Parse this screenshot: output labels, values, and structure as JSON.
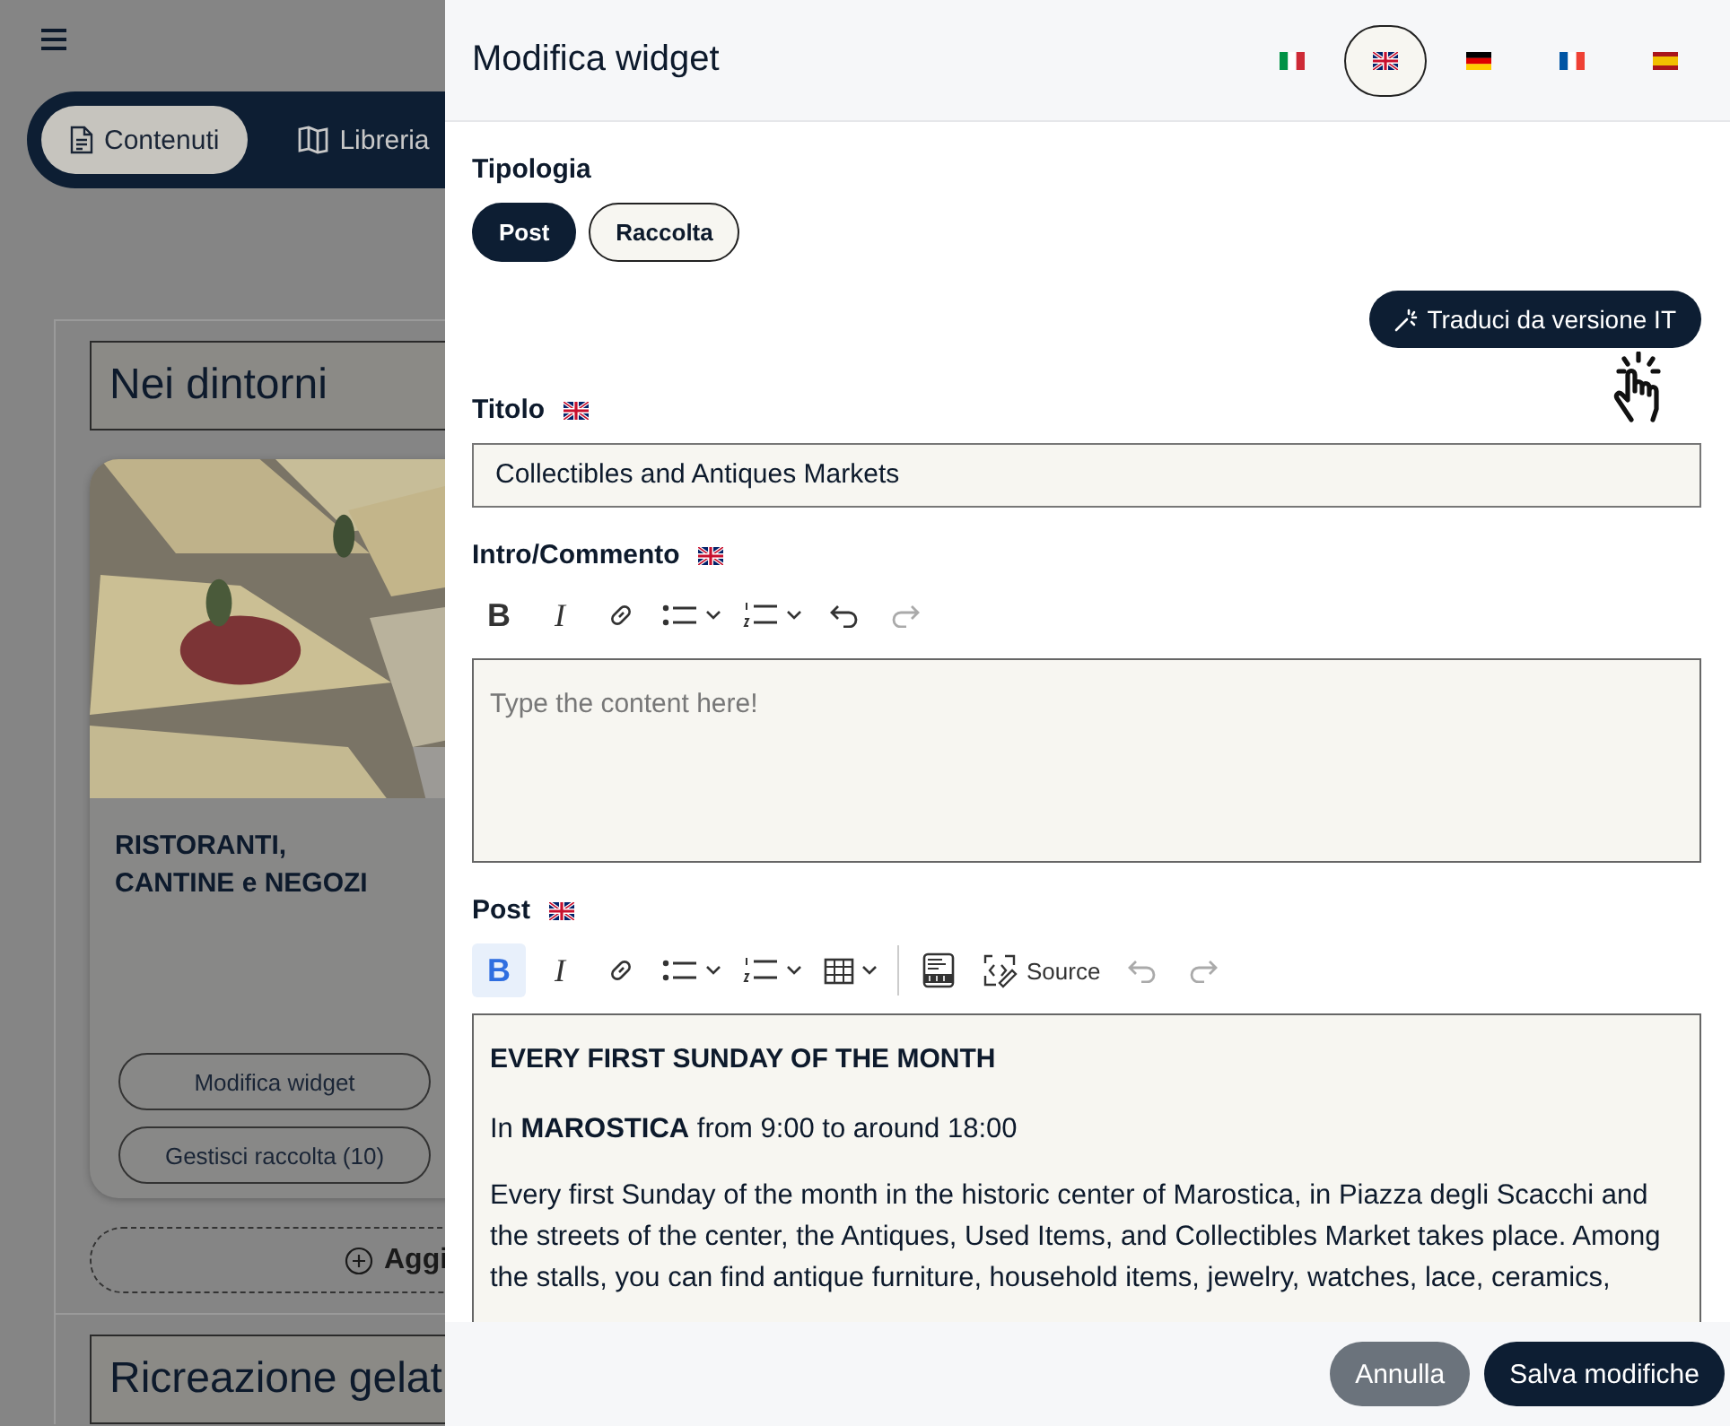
{
  "background": {
    "tabs": [
      {
        "label": "Contenuti",
        "selected": true
      },
      {
        "label": "Libreria",
        "selected": false
      }
    ],
    "sections": [
      {
        "title": "Nei dintorni",
        "card": {
          "title": "RISTORANTI,\nCANTINE e NEGOZI",
          "buttons": [
            "Modifica widget",
            "Gestisci raccolta (10)"
          ]
        },
        "add_button": "Aggi"
      },
      {
        "title": "Ricreazione gelat"
      }
    ]
  },
  "drawer": {
    "title": "Modifica widget",
    "languages": [
      {
        "kind": "it",
        "selected": false
      },
      {
        "kind": "en",
        "selected": true
      },
      {
        "kind": "de",
        "selected": false
      },
      {
        "kind": "fr",
        "selected": false
      },
      {
        "kind": "es",
        "selected": false
      }
    ],
    "type": {
      "label": "Tipologia",
      "options": [
        {
          "label": "Post",
          "selected": true
        },
        {
          "label": "Raccolta",
          "selected": false
        }
      ]
    },
    "translate_button": "Traduci da versione IT",
    "title_field": {
      "label": "Titolo",
      "value": "Collectibles and Antiques Markets"
    },
    "intro": {
      "label": "Intro/Commento",
      "placeholder": "Type the content here!",
      "toolbar": [
        [
          {
            "kind": "bold",
            "label": "B",
            "active": false,
            "disabled": false
          },
          {
            "kind": "italic",
            "label": "I",
            "active": false,
            "disabled": false
          },
          {
            "kind": "link",
            "active": false,
            "disabled": false
          },
          {
            "kind": "bulleted-list",
            "active": false,
            "disabled": false
          },
          {
            "kind": "numbered-list",
            "active": false,
            "disabled": false
          },
          {
            "kind": "undo",
            "active": false,
            "disabled": false
          },
          {
            "kind": "redo",
            "active": false,
            "disabled": true
          }
        ]
      ]
    },
    "post": {
      "label": "Post",
      "toolbar": [
        [
          {
            "kind": "bold",
            "label": "B",
            "active": true,
            "disabled": false
          },
          {
            "kind": "italic",
            "label": "I",
            "active": false,
            "disabled": false
          },
          {
            "kind": "link",
            "active": false,
            "disabled": false
          },
          {
            "kind": "bulleted-list",
            "active": false,
            "disabled": false
          },
          {
            "kind": "numbered-list",
            "active": false,
            "disabled": false
          },
          {
            "kind": "table",
            "active": false,
            "disabled": false
          }
        ],
        [
          {
            "kind": "html-embed",
            "active": false,
            "disabled": false
          },
          {
            "kind": "source",
            "label": "Source",
            "active": false,
            "disabled": false
          },
          {
            "kind": "undo",
            "active": false,
            "disabled": true
          },
          {
            "kind": "redo",
            "active": false,
            "disabled": true
          }
        ]
      ],
      "content": [
        {
          "kind": "heading",
          "text": "EVERY FIRST SUNDAY OF THE MONTH"
        },
        {
          "kind": "paragraph",
          "text": "In **MAROSTICA** from 9:00 to around 18:00"
        },
        {
          "kind": "paragraph",
          "text": "Every first Sunday of the month in the historic center of Marostica, in Piazza degli Scacchi and the streets of the center, the Antiques, Used Items, and Collectibles Market takes place. Among the stalls, you can find antique furniture, household items, jewelry, watches, lace, ceramics,"
        }
      ]
    },
    "buttons": [
      {
        "label": "Annulla",
        "kind": "secondary"
      },
      {
        "label": "Salva modifiche",
        "kind": "primary"
      }
    ]
  }
}
